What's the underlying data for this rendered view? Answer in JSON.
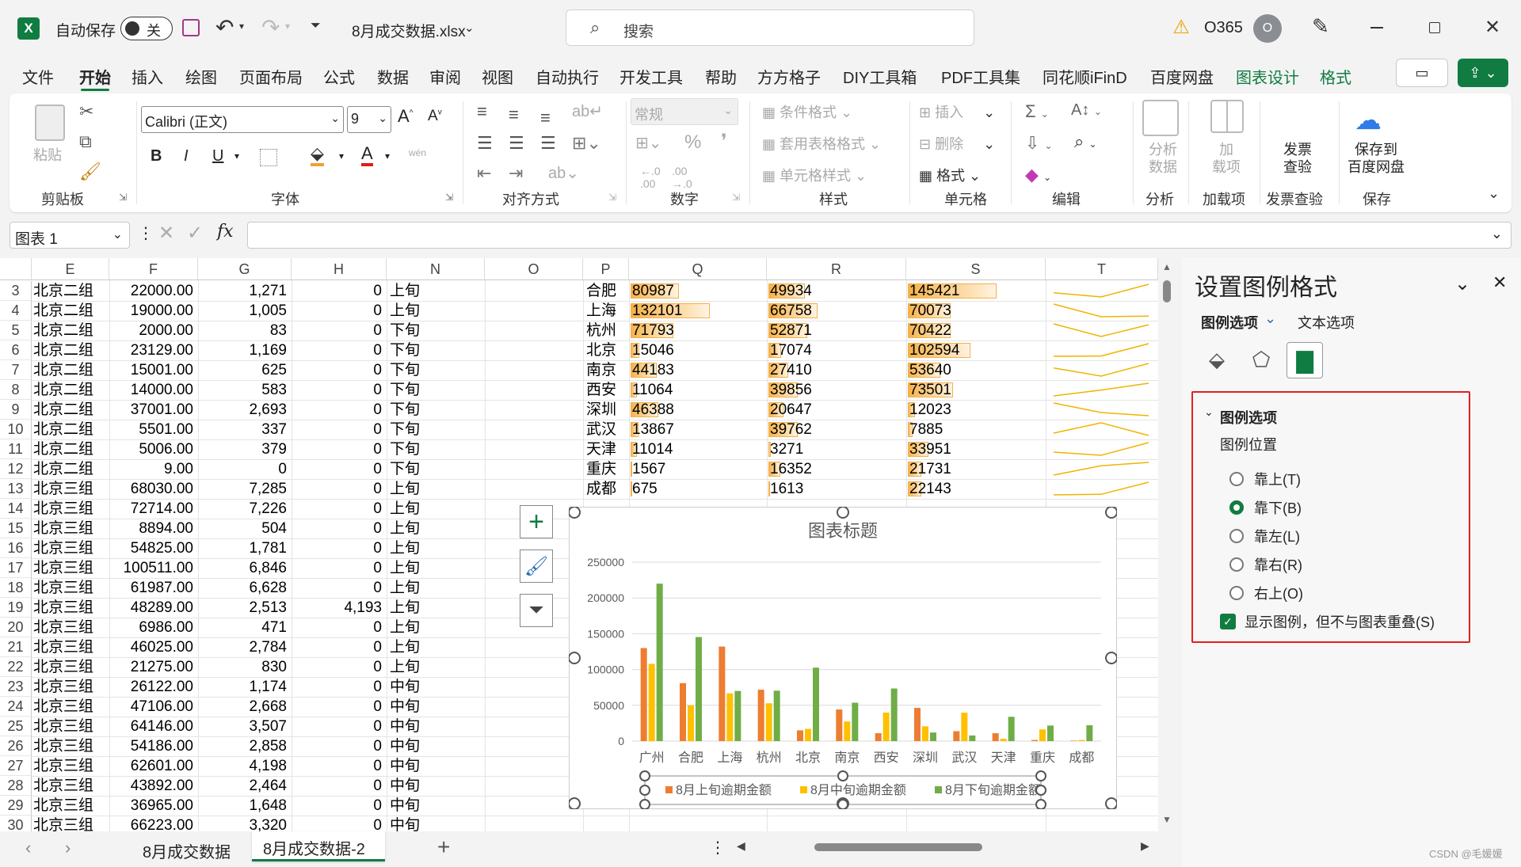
{
  "titlebar": {
    "autosave_label": "自动保存",
    "autosave_state": "关",
    "filename": "8月成交数据.xlsx",
    "search_placeholder": "搜索",
    "account": "O365",
    "avatar_letter": "O"
  },
  "ribbon_tabs": [
    "文件",
    "开始",
    "插入",
    "绘图",
    "页面布局",
    "公式",
    "数据",
    "审阅",
    "视图",
    "自动执行",
    "开发工具",
    "帮助",
    "方方格子",
    "DIY工具箱",
    "PDF工具集",
    "同花顺iFinD",
    "百度网盘",
    "图表设计",
    "格式"
  ],
  "ribbon": {
    "clipboard": {
      "paste": "粘贴",
      "group": "剪贴板"
    },
    "font": {
      "name": "Calibri (正文)",
      "size": "9",
      "group": "字体",
      "bold": "B",
      "italic": "I",
      "underline": "U",
      "wen": "wén"
    },
    "alignment": {
      "group": "对齐方式"
    },
    "number": {
      "format": "常规",
      "group": "数字"
    },
    "styles": {
      "conditional": "条件格式",
      "table": "套用表格格式",
      "cell": "单元格样式",
      "group": "样式"
    },
    "cells": {
      "insert": "插入",
      "delete": "删除",
      "format": "格式",
      "group": "单元格"
    },
    "editing": {
      "group": "编辑"
    },
    "analyze": {
      "label": "分析\n数据",
      "group": "分析"
    },
    "addins": {
      "label": "加\n载项",
      "group": "加载项"
    },
    "invoice": {
      "label": "发票\n查验",
      "group": "发票查验"
    },
    "save": {
      "label": "保存到\n百度网盘",
      "group": "保存"
    }
  },
  "formula_bar": {
    "name_box": "图表 1",
    "fx": "fx",
    "content": ""
  },
  "columns": [
    "E",
    "F",
    "G",
    "H",
    "N",
    "O",
    "P",
    "Q",
    "R",
    "S",
    "T"
  ],
  "rows": [
    {
      "n": "3",
      "e": "北京二组",
      "f": "22000.00",
      "g": "1,271",
      "h": "0",
      "nv": "上旬"
    },
    {
      "n": "4",
      "e": "北京二组",
      "f": "19000.00",
      "g": "1,005",
      "h": "0",
      "nv": "上旬"
    },
    {
      "n": "5",
      "e": "北京二组",
      "f": "2000.00",
      "g": "83",
      "h": "0",
      "nv": "下旬"
    },
    {
      "n": "6",
      "e": "北京二组",
      "f": "23129.00",
      "g": "1,169",
      "h": "0",
      "nv": "下旬"
    },
    {
      "n": "7",
      "e": "北京二组",
      "f": "15001.00",
      "g": "625",
      "h": "0",
      "nv": "下旬"
    },
    {
      "n": "8",
      "e": "北京二组",
      "f": "14000.00",
      "g": "583",
      "h": "0",
      "nv": "下旬"
    },
    {
      "n": "9",
      "e": "北京二组",
      "f": "37001.00",
      "g": "2,693",
      "h": "0",
      "nv": "下旬"
    },
    {
      "n": "10",
      "e": "北京二组",
      "f": "5501.00",
      "g": "337",
      "h": "0",
      "nv": "下旬"
    },
    {
      "n": "11",
      "e": "北京二组",
      "f": "5006.00",
      "g": "379",
      "h": "0",
      "nv": "下旬"
    },
    {
      "n": "12",
      "e": "北京二组",
      "f": "9.00",
      "g": "0",
      "h": "0",
      "nv": "下旬"
    },
    {
      "n": "13",
      "e": "北京三组",
      "f": "68030.00",
      "g": "7,285",
      "h": "0",
      "nv": "上旬"
    },
    {
      "n": "14",
      "e": "北京三组",
      "f": "72714.00",
      "g": "7,226",
      "h": "0",
      "nv": "上旬"
    },
    {
      "n": "15",
      "e": "北京三组",
      "f": "8894.00",
      "g": "504",
      "h": "0",
      "nv": "上旬"
    },
    {
      "n": "16",
      "e": "北京三组",
      "f": "54825.00",
      "g": "1,781",
      "h": "0",
      "nv": "上旬"
    },
    {
      "n": "17",
      "e": "北京三组",
      "f": "100511.00",
      "g": "6,846",
      "h": "0",
      "nv": "上旬"
    },
    {
      "n": "18",
      "e": "北京三组",
      "f": "61987.00",
      "g": "6,628",
      "h": "0",
      "nv": "上旬"
    },
    {
      "n": "19",
      "e": "北京三组",
      "f": "48289.00",
      "g": "2,513",
      "h": "4,193",
      "nv": "上旬"
    },
    {
      "n": "20",
      "e": "北京三组",
      "f": "6986.00",
      "g": "471",
      "h": "0",
      "nv": "上旬"
    },
    {
      "n": "21",
      "e": "北京三组",
      "f": "46025.00",
      "g": "2,784",
      "h": "0",
      "nv": "上旬"
    },
    {
      "n": "22",
      "e": "北京三组",
      "f": "21275.00",
      "g": "830",
      "h": "0",
      "nv": "上旬"
    },
    {
      "n": "23",
      "e": "北京三组",
      "f": "26122.00",
      "g": "1,174",
      "h": "0",
      "nv": "中旬"
    },
    {
      "n": "24",
      "e": "北京三组",
      "f": "47106.00",
      "g": "2,668",
      "h": "0",
      "nv": "中旬"
    },
    {
      "n": "25",
      "e": "北京三组",
      "f": "64146.00",
      "g": "3,507",
      "h": "0",
      "nv": "中旬"
    },
    {
      "n": "26",
      "e": "北京三组",
      "f": "54186.00",
      "g": "2,858",
      "h": "0",
      "nv": "中旬"
    },
    {
      "n": "27",
      "e": "北京三组",
      "f": "62601.00",
      "g": "4,198",
      "h": "0",
      "nv": "中旬"
    },
    {
      "n": "28",
      "e": "北京三组",
      "f": "43892.00",
      "g": "2,464",
      "h": "0",
      "nv": "中旬"
    },
    {
      "n": "29",
      "e": "北京三组",
      "f": "36965.00",
      "g": "1,648",
      "h": "0",
      "nv": "中旬"
    },
    {
      "n": "30",
      "e": "北京三组",
      "f": "66223.00",
      "g": "3,320",
      "h": "0",
      "nv": "中旬"
    }
  ],
  "city_table": [
    {
      "p": "合肥",
      "q": "80987",
      "r": "49934",
      "s": "145421"
    },
    {
      "p": "上海",
      "q": "132101",
      "r": "66758",
      "s": "70073"
    },
    {
      "p": "杭州",
      "q": "71793",
      "r": "52871",
      "s": "70422"
    },
    {
      "p": "北京",
      "q": "15046",
      "r": "17074",
      "s": "102594"
    },
    {
      "p": "南京",
      "q": "44183",
      "r": "27410",
      "s": "53640"
    },
    {
      "p": "西安",
      "q": "11064",
      "r": "39856",
      "s": "73501"
    },
    {
      "p": "深圳",
      "q": "46388",
      "r": "20647",
      "s": "12023"
    },
    {
      "p": "武汉",
      "q": "13867",
      "r": "39762",
      "s": "7885"
    },
    {
      "p": "天津",
      "q": "11014",
      "r": "3271",
      "s": "33951"
    },
    {
      "p": "重庆",
      "q": "1567",
      "r": "16352",
      "s": "21731"
    },
    {
      "p": "成都",
      "q": "675",
      "r": "1613",
      "s": "22143"
    }
  ],
  "chart_data": {
    "type": "bar",
    "title": "图表标题",
    "categories": [
      "广州",
      "合肥",
      "上海",
      "杭州",
      "北京",
      "南京",
      "西安",
      "深圳",
      "武汉",
      "天津",
      "重庆",
      "成都"
    ],
    "series": [
      {
        "name": "8月上旬逾期金额",
        "color": "#ed7d31",
        "values": [
          130000,
          80987,
          132101,
          71793,
          15046,
          44183,
          11064,
          46388,
          13867,
          11014,
          1567,
          675
        ]
      },
      {
        "name": "8月中旬逾期金额",
        "color": "#ffc000",
        "values": [
          108000,
          49934,
          66758,
          52871,
          17074,
          27410,
          39856,
          20647,
          39762,
          3271,
          16352,
          1613
        ]
      },
      {
        "name": "8月下旬逾期金额",
        "color": "#70ad47",
        "values": [
          220000,
          145421,
          70073,
          70422,
          102594,
          53640,
          73501,
          12023,
          7885,
          33951,
          21731,
          22143
        ]
      }
    ],
    "ylim": [
      0,
      250000
    ],
    "yticks": [
      "250000",
      "200000",
      "150000",
      "100000",
      "50000",
      "0"
    ],
    "legend_position": "bottom",
    "grid": true
  },
  "pane": {
    "title": "设置图例格式",
    "tab_legend": "图例选项",
    "tab_text": "文本选项",
    "section": "图例选项",
    "position_label": "图例位置",
    "options": [
      "靠上(T)",
      "靠下(B)",
      "靠左(L)",
      "靠右(R)",
      "右上(O)"
    ],
    "selected": "靠下(B)",
    "checkbox": "显示图例，但不与图表重叠(S)"
  },
  "sheets": [
    "8月成交数据",
    "8月成交数据-2"
  ],
  "active_sheet": "8月成交数据-2",
  "watermark": "CSDN @毛媛媛"
}
